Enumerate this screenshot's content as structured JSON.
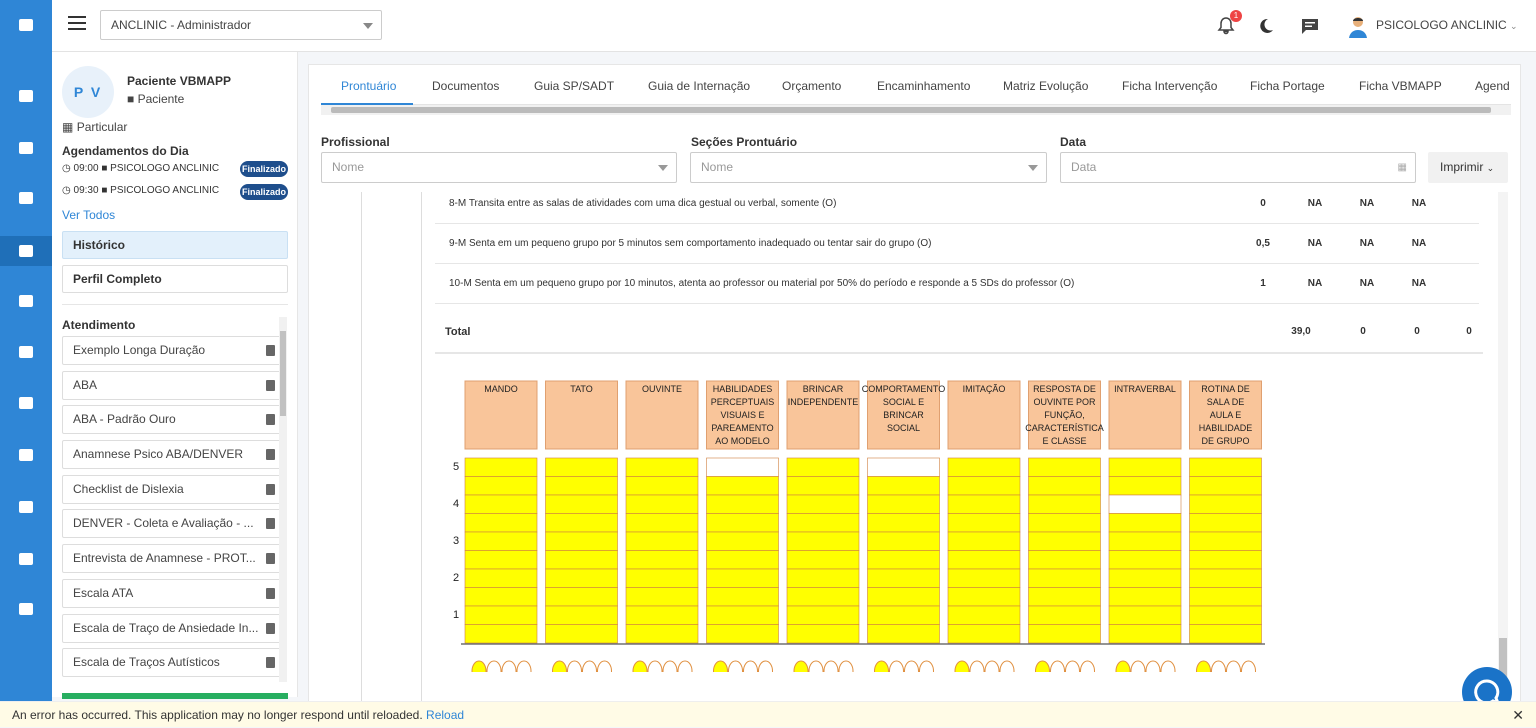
{
  "topbar": {
    "org": "ANCLINIC - Administrador",
    "notif_count": "1",
    "user": "PSICOLOGO ANCLINIC"
  },
  "patient": {
    "initials": "P V",
    "name": "Paciente VBMAPP",
    "role": "Paciente",
    "type": "Particular"
  },
  "agenda": {
    "title": "Agendamentos do Dia",
    "items": [
      {
        "time": "09:00",
        "who": "PSICOLOGO ANCLINIC",
        "status": "Finalizado"
      },
      {
        "time": "09:30",
        "who": "PSICOLOGO ANCLINIC",
        "status": "Finalizado"
      }
    ],
    "ver_todos": "Ver Todos"
  },
  "nav": {
    "historico": "Histórico",
    "perfil": "Perfil Completo"
  },
  "atendimento": {
    "title": "Atendimento",
    "items": [
      "Exemplo Longa Duração",
      "ABA",
      "ABA - Padrão Ouro",
      "Anamnese Psico ABA/DENVER",
      "Checklist de Dislexia",
      "DENVER - Coleta e Avaliação - ...",
      "Entrevista de Anamnese - PROT...",
      "Escala ATA",
      "Escala de Traço de Ansiedade In...",
      "Escala de Traços Autísticos"
    ]
  },
  "tabs": [
    "Prontuário",
    "Documentos",
    "Guia SP/SADT",
    "Guia de Internação",
    "Orçamento",
    "Encaminhamento",
    "Matriz Evolução",
    "Ficha Intervenção",
    "Ficha Portage",
    "Ficha VBMAPP",
    "Agend"
  ],
  "filters": {
    "profissional_label": "Profissional",
    "profissional_ph": "Nome",
    "secoes_label": "Seções Prontuário",
    "secoes_ph": "Nome",
    "data_label": "Data",
    "data_ph": "Data",
    "print": "Imprimir"
  },
  "rows": [
    {
      "desc": "8-M Transita entre as salas de atividades com uma dica gestual ou verbal, somente (O)",
      "vals": [
        "0",
        "NA",
        "NA",
        "NA"
      ]
    },
    {
      "desc": "9-M Senta em um pequeno grupo por 5 minutos sem comportamento inadequado ou tentar sair do grupo (O)",
      "vals": [
        "0,5",
        "NA",
        "NA",
        "NA"
      ]
    },
    {
      "desc": "10-M Senta em um pequeno grupo por 10 minutos, atenta ao professor ou material por 50% do período e responde a 5 SDs do professor (O)",
      "vals": [
        "1",
        "NA",
        "NA",
        "NA"
      ]
    }
  ],
  "total": {
    "label": "Total",
    "vals": [
      "39,0",
      "0",
      "0",
      "0"
    ]
  },
  "grid": {
    "columns": [
      "MANDO",
      "TATO",
      "OUVINTE",
      "HABILIDADES PERCEPTUAIS VISUAIS E PAREAMENTO AO MODELO",
      "BRINCAR INDEPENDENTE",
      "COMPORTAMENTO SOCIAL E BRINCAR SOCIAL",
      "IMITAÇÃO",
      "RESPOSTA DE OUVINTE POR FUNÇÃO, CARACTERÍSTICA E CLASSE",
      "INTRAVERBAL",
      "ROTINA DE SALA DE AULA E HABILIDADE DE GRUPO"
    ],
    "levels": [
      "5",
      "4",
      "3",
      "2",
      "1"
    ],
    "filled": [
      [
        1,
        1,
        1,
        1,
        1,
        1,
        1,
        1,
        1,
        1
      ],
      [
        1,
        1,
        1,
        1,
        1,
        1,
        1,
        1,
        1,
        1
      ],
      [
        1,
        1,
        1,
        1,
        1,
        1,
        1,
        1,
        1,
        1
      ],
      [
        0,
        1,
        1,
        1,
        1,
        1,
        1,
        1,
        1,
        1
      ],
      [
        1,
        1,
        1,
        1,
        1,
        1,
        1,
        1,
        1,
        1
      ],
      [
        0,
        1,
        1,
        1,
        1,
        1,
        1,
        1,
        1,
        1
      ],
      [
        1,
        1,
        1,
        1,
        1,
        1,
        1,
        1,
        1,
        1
      ],
      [
        1,
        1,
        1,
        1,
        1,
        1,
        1,
        1,
        1,
        1
      ],
      [
        1,
        1,
        0,
        1,
        1,
        1,
        1,
        1,
        1,
        1
      ],
      [
        1,
        1,
        1,
        1,
        1,
        1,
        1,
        1,
        1,
        1
      ]
    ],
    "circles_filled": [
      1,
      1,
      1,
      1,
      1,
      1,
      1,
      1,
      1,
      1
    ]
  },
  "error": {
    "msg": "An error has occurred. This application may no longer respond until reloaded.",
    "reload": "Reload"
  }
}
